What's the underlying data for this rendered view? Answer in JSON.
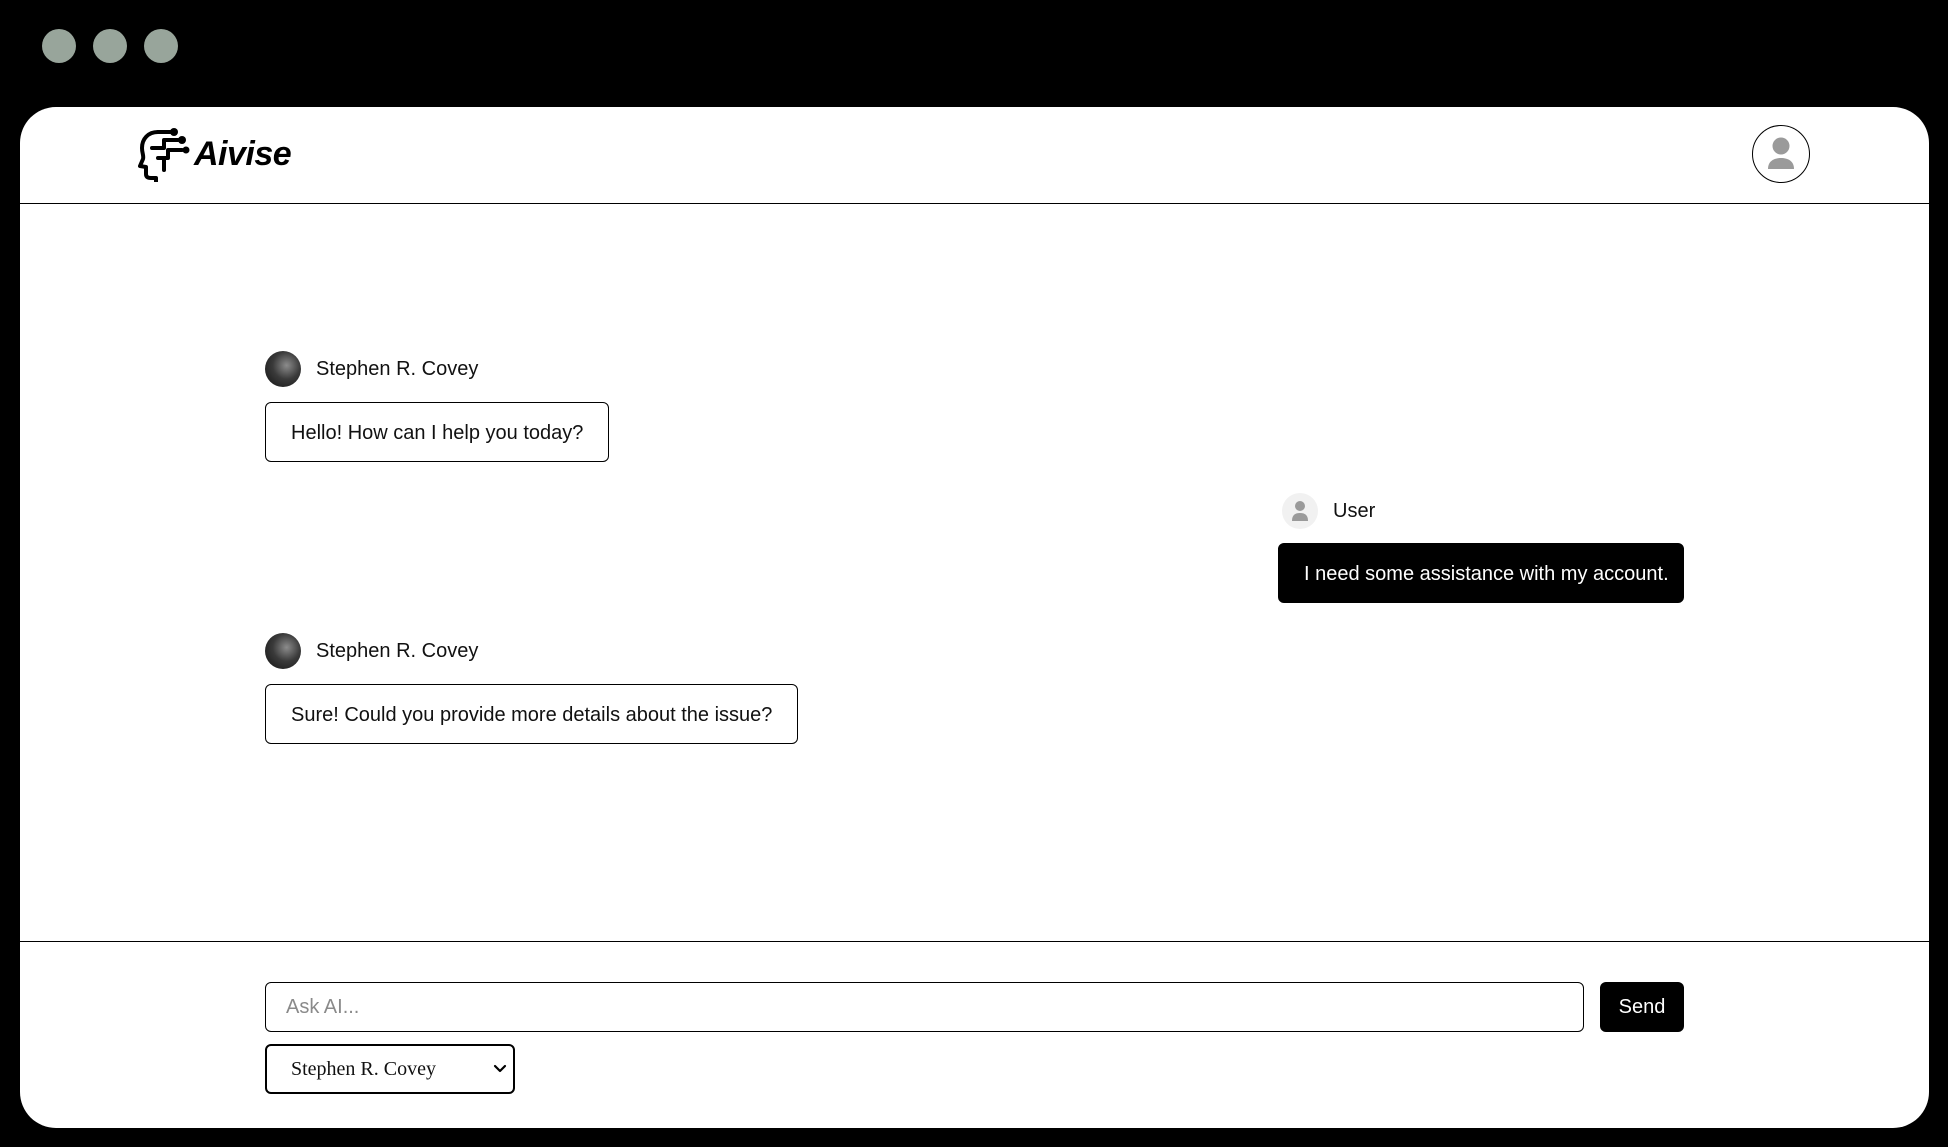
{
  "brand": {
    "name": "Aivise"
  },
  "colors": {
    "frame": "#000000",
    "window_dots": "#98a59b",
    "accent": "#000000"
  },
  "header": {
    "profile_icon": "user-circle-icon"
  },
  "messages": [
    {
      "role": "assistant",
      "sender": "Stephen R. Covey",
      "text": "Hello! How can I help you today?"
    },
    {
      "role": "user",
      "sender": "User",
      "text": "I need some assistance with my account."
    },
    {
      "role": "assistant",
      "sender": "Stephen R. Covey",
      "text": "Sure! Could you provide more details about the issue?"
    }
  ],
  "composer": {
    "placeholder": "Ask AI...",
    "value": "",
    "send_label": "Send",
    "persona_selected": "Stephen R. Covey"
  }
}
